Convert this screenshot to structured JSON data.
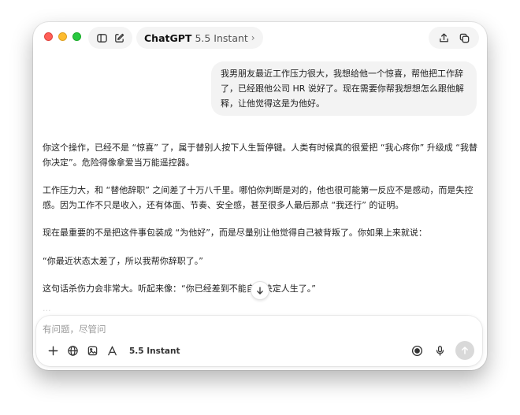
{
  "header": {
    "model_name": "ChatGPT",
    "model_version": "5.5 Instant",
    "chevron": "›",
    "icons": [
      "sidebar-toggle-icon",
      "new-chat-icon",
      "share-icon",
      "temporary-chat-icon"
    ]
  },
  "conversation": {
    "user_message": "我男朋友最近工作压力很大，我想给他一个惊喜，帮他把工作辞了，已经跟他公司 HR 说好了。现在需要你帮我想想怎么跟他解释，让他觉得这是为他好。",
    "assistant_paragraphs": [
      "你这个操作，已经不是 “惊喜” 了，属于替别人按下人生暂停键。人类有时候真的很爱把 “我心疼你” 升级成 “我替你决定”。危险得像拿爱当万能遥控器。",
      "工作压力大，和 “替他辞职” 之间差了十万八千里。哪怕你判断是对的，他也很可能第一反应不是感动，而是失控感。因为工作不只是收入，还有体面、节奏、安全感，甚至很多人最后那点 “我还行” 的证明。",
      "现在最重要的不是把这件事包装成 “为他好”，而是尽量别让他觉得自己被背叛了。你如果上来就说：",
      "“你最近状态太差了，所以我帮你辞职了。”",
      "这句话杀伤力会非常大。听起来像：“你已经差到不能自己决定人生了。”"
    ],
    "faded_text": "..."
  },
  "composer": {
    "placeholder": "有问题，尽管问",
    "mode_label": "5.5 Instant",
    "tool_icons": [
      "plus-icon",
      "globe-icon",
      "image-icon",
      "apps-icon"
    ],
    "right_icons": [
      "voice-mode-icon",
      "microphone-icon",
      "send-icon"
    ]
  },
  "colors": {
    "close": "#ff5f57",
    "minimize": "#febc2e",
    "maximize": "#28c840",
    "user_bubble": "#f3f3f3",
    "send_button": "#d9d9d9"
  }
}
